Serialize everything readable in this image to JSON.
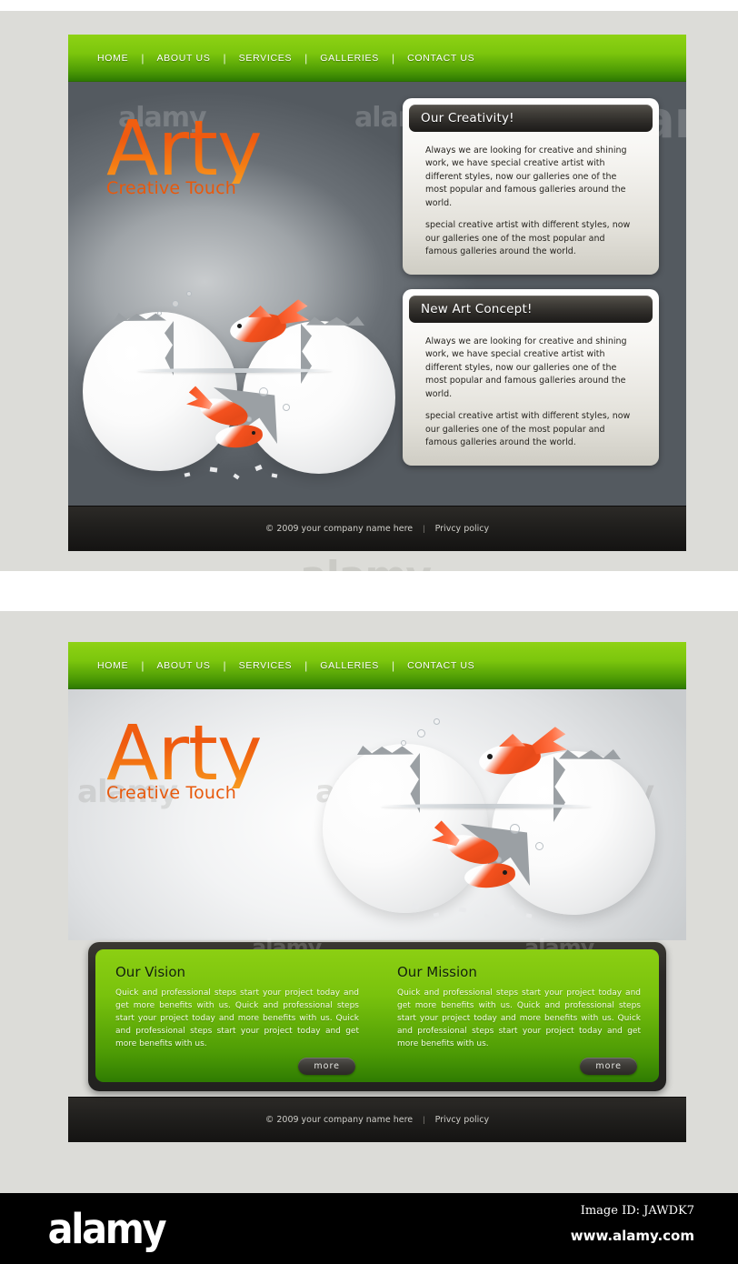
{
  "nav": {
    "items": [
      {
        "label": "HOME"
      },
      {
        "label": "ABOUT US"
      },
      {
        "label": "SERVICES"
      },
      {
        "label": "GALLERIES"
      },
      {
        "label": "CONTACT US"
      }
    ],
    "separator": "|"
  },
  "brand": {
    "name": "Arty",
    "tagline": "Creative Touch"
  },
  "mockup_a": {
    "panels": [
      {
        "title": "Our Creativity!",
        "paragraph_1": "Always we are looking for creative and shining work, we have special creative artist with different styles, now our galleries one of the most popular and famous galleries around the world.",
        "paragraph_2": "special creative artist with different styles, now our galleries one of the most popular and famous galleries around the world."
      },
      {
        "title": "New Art Concept!",
        "paragraph_1": "Always we are looking for creative and shining work, we have special creative artist with different styles, now our galleries one of the most popular and famous galleries around the world.",
        "paragraph_2": "special creative artist with different styles, now our galleries one of the most popular and famous galleries around the world."
      }
    ]
  },
  "mockup_b": {
    "features": [
      {
        "title": "Our Vision",
        "text": "Quick and professional steps start your project today and get more benefits with us. Quick and professional steps start your project today and more benefits with us. Quick and professional steps start your project today and get more benefits with us.",
        "button": "more"
      },
      {
        "title": "Our Mission",
        "text": "Quick and professional steps start your project today and get more benefits with us. Quick and professional steps start your project today and more benefits with us. Quick and professional steps start your project today and get more benefits with us.",
        "button": "more"
      }
    ]
  },
  "footer": {
    "copyright": "© 2009 your company name here",
    "separator": "|",
    "privacy": "Privcy policy"
  },
  "watermark": {
    "text": "alamy",
    "image_id": "Image ID: JAWDK7",
    "url": "www.alamy.com"
  },
  "colors": {
    "green_light": "#8ed214",
    "green_dark": "#2e7a02",
    "orange": "#f0600f",
    "panel_dark": "#2a2825",
    "hero_dark": "#545a60",
    "page_bg": "#dcdcd8"
  }
}
